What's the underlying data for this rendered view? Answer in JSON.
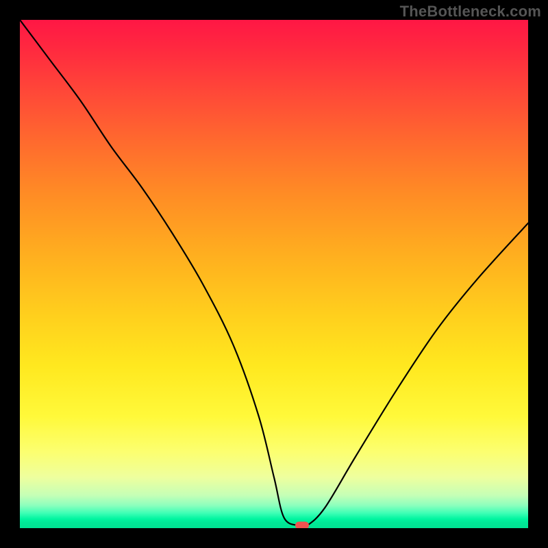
{
  "attribution": "TheBottleneck.com",
  "chart_data": {
    "type": "line",
    "title": "",
    "xlabel": "",
    "ylabel": "",
    "xlim": [
      0,
      100
    ],
    "ylim": [
      0,
      100
    ],
    "x": [
      0,
      6,
      12,
      18,
      24,
      30,
      36,
      42,
      47,
      50,
      52,
      55,
      56.5,
      60,
      66,
      74,
      82,
      90,
      100
    ],
    "values": [
      100,
      92,
      84,
      75,
      67,
      58,
      48,
      36,
      22,
      10,
      2,
      0.5,
      0.5,
      4,
      14,
      27,
      39,
      49,
      60
    ],
    "marker": {
      "x": 55.5,
      "y": 0.5
    },
    "colors": {
      "curve": "#000000",
      "marker": "#ef5350",
      "gradient_top": "#ff1745",
      "gradient_bottom": "#00e493"
    }
  }
}
